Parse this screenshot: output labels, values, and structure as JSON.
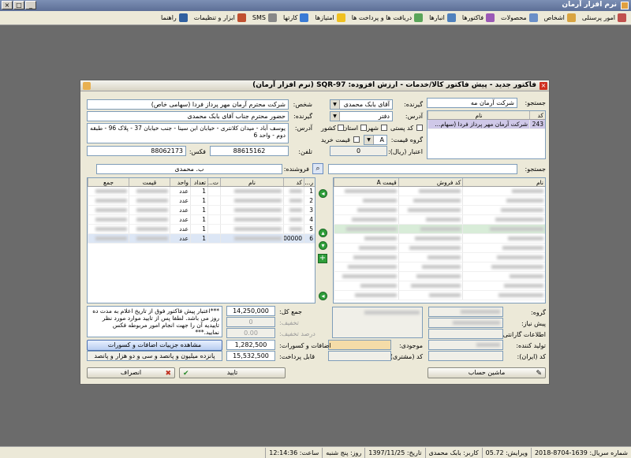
{
  "app": {
    "title": "نرم افزار آرمان",
    "win_min": "_",
    "win_max": "□",
    "win_close": "×"
  },
  "menu": [
    {
      "label": "امور پرسنلی",
      "icon": "personnel-icon",
      "color": "#c0504d"
    },
    {
      "label": "اشخاص",
      "icon": "people-icon",
      "color": "#d9a441"
    },
    {
      "label": "محصولات",
      "icon": "products-icon",
      "color": "#6a8fc8"
    },
    {
      "label": "فاکتورها",
      "icon": "invoice-icon",
      "color": "#9b59b6"
    },
    {
      "label": "انبارها",
      "icon": "warehouse-icon",
      "color": "#4f81bd"
    },
    {
      "label": "دریافت ها و پرداخت ها",
      "icon": "payments-icon",
      "color": "#5aa55a"
    },
    {
      "label": "امتیازها",
      "icon": "star-icon",
      "color": "#f0c020"
    },
    {
      "label": "کارتها",
      "icon": "cards-icon",
      "color": "#3a7bd5"
    },
    {
      "label": "SMS",
      "icon": "sms-icon",
      "color": "#888888"
    },
    {
      "label": "ابزار و تنظیمات",
      "icon": "tools-icon",
      "color": "#c05030"
    },
    {
      "label": "راهنما",
      "icon": "help-icon",
      "color": "#3060a0"
    }
  ],
  "dialog": {
    "title": "فاکتور جدید - پیش فاکتور کالا/خدمات - ارزش افزوده: 97-SQR (نرم افزار آرمان)",
    "search_label": "جستجو:",
    "search_value": "شرکت آرمان مه",
    "customer_list_head": {
      "code": "کد",
      "name": "نام"
    },
    "customer_row": {
      "code": "243",
      "name": "شرکت آرمان مهر پرداز فردا (سهام..."
    },
    "receiver_label": "گیرنده:",
    "receiver_value": "آقای بابک محمدی",
    "person_label": "شخص:",
    "person_value": "شرکت محترم آرمان مهر پرداز فردا (سهامی خاص)",
    "address_label": "آدرس:",
    "address_value": "دفتر",
    "receiver2_label": "گیرنده:",
    "receiver2_value": "حضور محترم جناب آقای بابک محمدی",
    "country_label": "کشور",
    "province_label": "استان",
    "city_label": "شهر",
    "postal_label": "کد پستی",
    "price_group_label": "گروه قیمت:",
    "price_group_value": "A",
    "buy_price_label": "قیمت خرید",
    "address2_label": "آدرس:",
    "address2_value": "یوسف آباد - میدان کلانتری - خیابان ابن سینا - جنب خیابان 37 - پلاک 96 - طبقه دوم - واحد 6",
    "credit_label": "اعتبار (ریال):",
    "credit_value": "0",
    "phone_label": "تلفن:",
    "phone_value": "88615162",
    "fax_label": "فکس:",
    "fax_value": "88062173",
    "search2_label": "جستجو:",
    "seller_label": "فروشنده:",
    "seller_value": "ب. محمدی",
    "product_head": {
      "name": "نام",
      "sale_code": "کد فروش",
      "price": "قیمت A"
    },
    "items_head": {
      "row": "ر...",
      "code": "کد",
      "name": "نام",
      "t": "ت...",
      "qty": "تعداد",
      "unit": "واحد",
      "price": "قیمت",
      "total": "جمع"
    },
    "items": [
      {
        "row": "1",
        "qty": "1",
        "unit": "عدد"
      },
      {
        "row": "2",
        "qty": "1",
        "unit": "عدد"
      },
      {
        "row": "3",
        "qty": "1",
        "unit": "عدد"
      },
      {
        "row": "4",
        "qty": "1",
        "unit": "عدد"
      },
      {
        "row": "5",
        "qty": "1",
        "unit": "عدد"
      },
      {
        "row": "6",
        "code": "00000",
        "qty": "1",
        "unit": "عدد"
      }
    ],
    "group_label": "گروه:",
    "need_label": "پیش نیاز:",
    "warranty_label": "اطلاعات گارانتی:",
    "producer_label": "تولید کننده:",
    "barcode_label": "کد (ایران):",
    "stock_label": "موجودی:",
    "code_customer_label": "کد (مشتری):",
    "sum_label": "جمع کل:",
    "sum_value": "14,250,000",
    "discount_label": "تخفیف:",
    "discount_value": "0",
    "discount_pct_label": "درصد تخفیف:",
    "discount_pct_value": "0.00",
    "additions_label": "اضافات و کسورات:",
    "additions_value": "1,282,500",
    "payable_label": "قابل پرداخت:",
    "payable_value": "15,532,500",
    "note": "***اعتبار پیش فاکتور فوق از تاریخ اعلام به مدت ده روز می باشد. لطفا پس از تایید موارد مورد نظر تاییدیه آن را جهت انجام امور مربوطه فکس نمایید.***",
    "details_btn": "مشاهده جزییات اضافات و کسورات",
    "amount_words": "پانزده میلیون و پانصد و سی و دو هزار و پانصد",
    "calc_btn": "ماشین حساب",
    "ok_btn": "تایید",
    "cancel_btn": "انصراف"
  },
  "status": [
    {
      "label": "شماره سریال: 1639-8704-2018"
    },
    {
      "label": "ویرایش: 05.72"
    },
    {
      "label": "کاربر: بابک محمدی"
    },
    {
      "label": "تاریخ: 1397/11/25"
    },
    {
      "label": "روز: پنج شنبه"
    },
    {
      "label": "ساعت: 12:14:36"
    }
  ]
}
